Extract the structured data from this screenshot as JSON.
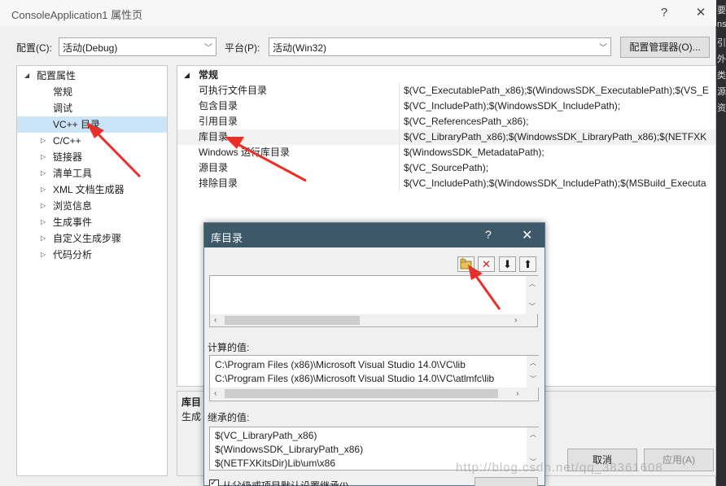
{
  "window": {
    "title": "ConsoleApplication1 属性页",
    "help_glyph": "?",
    "close_glyph": "✕"
  },
  "config": {
    "config_label": "配置(C):",
    "config_value": "活动(Debug)",
    "platform_label": "平台(P):",
    "platform_value": "活动(Win32)",
    "manager_button": "配置管理器(O)..."
  },
  "tree": {
    "root": "配置属性",
    "items": [
      {
        "label": "常规",
        "expandable": false,
        "selected": false
      },
      {
        "label": "调试",
        "expandable": false,
        "selected": false
      },
      {
        "label": "VC++ 目录",
        "expandable": false,
        "selected": true
      },
      {
        "label": "C/C++",
        "expandable": true,
        "selected": false
      },
      {
        "label": "链接器",
        "expandable": true,
        "selected": false
      },
      {
        "label": "清单工具",
        "expandable": true,
        "selected": false
      },
      {
        "label": "XML 文档生成器",
        "expandable": true,
        "selected": false
      },
      {
        "label": "浏览信息",
        "expandable": true,
        "selected": false
      },
      {
        "label": "生成事件",
        "expandable": true,
        "selected": false
      },
      {
        "label": "自定义生成步骤",
        "expandable": true,
        "selected": false
      },
      {
        "label": "代码分析",
        "expandable": true,
        "selected": false
      }
    ]
  },
  "grid": {
    "category": "常规",
    "rows": [
      {
        "name": "可执行文件目录",
        "value": "$(VC_ExecutablePath_x86);$(WindowsSDK_ExecutablePath);$(VS_E"
      },
      {
        "name": "包含目录",
        "value": "$(VC_IncludePath);$(WindowsSDK_IncludePath);"
      },
      {
        "name": "引用目录",
        "value": "$(VC_ReferencesPath_x86);"
      },
      {
        "name": "库目录",
        "value": "$(VC_LibraryPath_x86);$(WindowsSDK_LibraryPath_x86);$(NETFXK"
      },
      {
        "name": "Windows 运行库目录",
        "value": "$(WindowsSDK_MetadataPath);"
      },
      {
        "name": "源目录",
        "value": "$(VC_SourcePath);"
      },
      {
        "name": "排除目录",
        "value": "$(VC_IncludePath);$(WindowsSDK_IncludePath);$(MSBuild_Executa"
      }
    ]
  },
  "description": {
    "title": "库目",
    "text": "生成"
  },
  "dialog": {
    "title": "库目录",
    "help_glyph": "?",
    "close_glyph": "✕",
    "computed_label": "计算的值:",
    "computed_lines": [
      "C:\\Program Files (x86)\\Microsoft Visual Studio 14.0\\VC\\lib",
      "C:\\Program Files (x86)\\Microsoft Visual Studio 14.0\\VC\\atlmfc\\lib"
    ],
    "inherited_label": "继承的值:",
    "inherited_lines": [
      "$(VC_LibraryPath_x86)",
      "$(WindowsSDK_LibraryPath_x86)",
      "$(NETFXKitsDir)Lib\\um\\x86"
    ],
    "inherit_checkbox": "从父级或项目默认设置继承(I)"
  },
  "buttons": {
    "cancel": "取消",
    "apply": "应用(A)"
  },
  "watermark": "http://blog.csdn.net/qq_38361608",
  "edge_chars": [
    "要",
    "ns",
    "引",
    "外",
    "类",
    "源",
    "资"
  ],
  "colors": {
    "dialog_title_bg": "#3d5869",
    "selection": "#cce4f7",
    "arrow": "#e8302a"
  }
}
